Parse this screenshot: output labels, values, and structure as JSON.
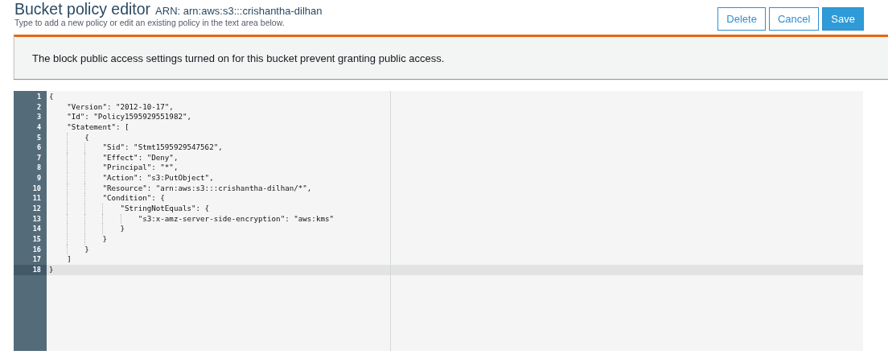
{
  "header": {
    "title": "Bucket policy editor",
    "arn": "ARN: arn:aws:s3:::crishantha-dilhan",
    "subtitle": "Type to add a new policy or edit an existing policy in the text area below."
  },
  "buttons": [
    {
      "label": "Delete",
      "kind": "secondary"
    },
    {
      "label": "Cancel",
      "kind": "secondary"
    },
    {
      "label": "Save",
      "kind": "primary"
    }
  ],
  "alert": {
    "message": "The block public access settings turned on for this bucket prevent granting public access."
  },
  "editor": {
    "lines": [
      {
        "number": "1",
        "text": "{",
        "active": false
      },
      {
        "number": "2",
        "text": "    \"Version\": \"2012-10-17\",",
        "active": false
      },
      {
        "number": "3",
        "text": "    \"Id\": \"Policy1595929551982\",",
        "active": false
      },
      {
        "number": "4",
        "text": "    \"Statement\": [",
        "active": false
      },
      {
        "number": "5",
        "text": "        {",
        "active": false
      },
      {
        "number": "6",
        "text": "            \"Sid\": \"Stmt1595929547562\",",
        "active": false
      },
      {
        "number": "7",
        "text": "            \"Effect\": \"Deny\",",
        "active": false
      },
      {
        "number": "8",
        "text": "            \"Principal\": \"*\",",
        "active": false
      },
      {
        "number": "9",
        "text": "            \"Action\": \"s3:PutObject\",",
        "active": false
      },
      {
        "number": "10",
        "text": "            \"Resource\": \"arn:aws:s3:::crishantha-dilhan/*\",",
        "active": false
      },
      {
        "number": "11",
        "text": "            \"Condition\": {",
        "active": false
      },
      {
        "number": "12",
        "text": "                \"StringNotEquals\": {",
        "active": false
      },
      {
        "number": "13",
        "text": "                    \"s3:x-amz-server-side-encryption\": \"aws:kms\"",
        "active": false
      },
      {
        "number": "14",
        "text": "                }",
        "active": false
      },
      {
        "number": "15",
        "text": "            }",
        "active": false
      },
      {
        "number": "16",
        "text": "        }",
        "active": false
      },
      {
        "number": "17",
        "text": "    ]",
        "active": false
      },
      {
        "number": "18",
        "text": "}",
        "active": true
      }
    ]
  }
}
